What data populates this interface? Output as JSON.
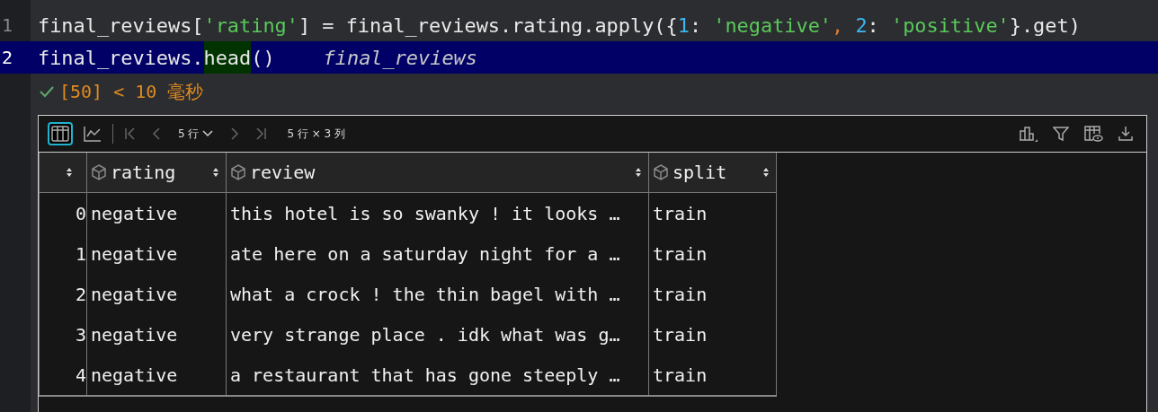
{
  "editor": {
    "lines": [
      {
        "number": "1",
        "current": false,
        "tokens": [
          {
            "kind": "plain",
            "text": "final_reviews["
          },
          {
            "kind": "string",
            "text": "'rating'"
          },
          {
            "kind": "plain",
            "text": "] = final_reviews.rating.apply({"
          },
          {
            "kind": "number",
            "text": "1"
          },
          {
            "kind": "plain",
            "text": ": "
          },
          {
            "kind": "string",
            "text": "'negative'"
          },
          {
            "kind": "operator",
            "text": ","
          },
          {
            "kind": "number",
            "text": " 2"
          },
          {
            "kind": "plain",
            "text": ": "
          },
          {
            "kind": "string",
            "text": "'positive'"
          },
          {
            "kind": "plain",
            "text": "}.get)"
          }
        ]
      },
      {
        "number": "2",
        "current": true,
        "tokens": [
          {
            "kind": "plain",
            "text": "final_reviews."
          },
          {
            "kind": "match",
            "text": "head"
          },
          {
            "kind": "plain",
            "text": "()"
          },
          {
            "kind": "hint",
            "text": "final_reviews"
          }
        ]
      }
    ],
    "status": {
      "text": "[50] < 10 毫秒"
    }
  },
  "output": {
    "toolbar": {
      "views": [
        {
          "kind": "table",
          "selected": true
        },
        {
          "kind": "chart",
          "selected": false
        }
      ],
      "row_count": "5 行",
      "shape": "5 行 × 3 列"
    },
    "table": {
      "columns": [
        {
          "label": "rating"
        },
        {
          "label": "review"
        },
        {
          "label": "split"
        }
      ],
      "rows": [
        {
          "index": "0",
          "cells": [
            "negative",
            "this hotel is so swanky ! it looks …",
            "train"
          ]
        },
        {
          "index": "1",
          "cells": [
            "negative",
            "ate here on a saturday night for a …",
            "train"
          ]
        },
        {
          "index": "2",
          "cells": [
            "negative",
            "what a crock ! the thin bagel with …",
            "train"
          ]
        },
        {
          "index": "3",
          "cells": [
            "negative",
            "very strange place . idk what was g…",
            "train"
          ]
        },
        {
          "index": "4",
          "cells": [
            "negative",
            "a restaurant that has gone steeply …",
            "train"
          ]
        }
      ]
    }
  }
}
